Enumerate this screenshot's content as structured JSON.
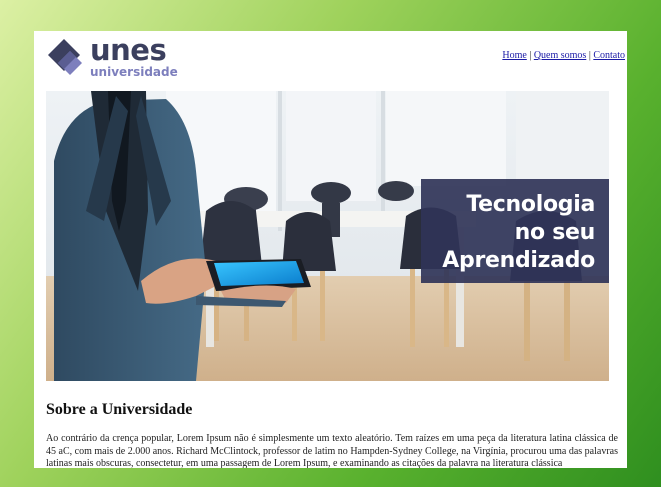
{
  "brand": {
    "name": "unes",
    "subtitle": "universidade",
    "colors": {
      "primary": "#3b3f5e",
      "secondary": "#7d7fbd"
    }
  },
  "nav": {
    "items": [
      {
        "label": "Home"
      },
      {
        "label": "Quem somos"
      },
      {
        "label": "Contato"
      }
    ],
    "separator": "|"
  },
  "hero": {
    "line1": "Tecnologia",
    "line2": "no seu",
    "line3": "Aprendizado"
  },
  "about": {
    "title": "Sobre a Universidade",
    "body": "Ao contrário da crença popular, Lorem Ipsum não é simplesmente um texto aleatório. Tem raízes em uma peça da literatura latina clássica de 45 aC, com mais de 2.000 anos. Richard McClintock, professor de latim no Hampden-Sydney College, na Virgínia, procurou uma das palavras latinas mais obscuras, consectetur, em uma passagem de Lorem Ipsum, e examinando as citações da palavra na literatura clássica"
  },
  "background": {
    "gradient": [
      "#dcf0a4",
      "#9fd25c",
      "#59b12e",
      "#2f8f1f"
    ]
  }
}
